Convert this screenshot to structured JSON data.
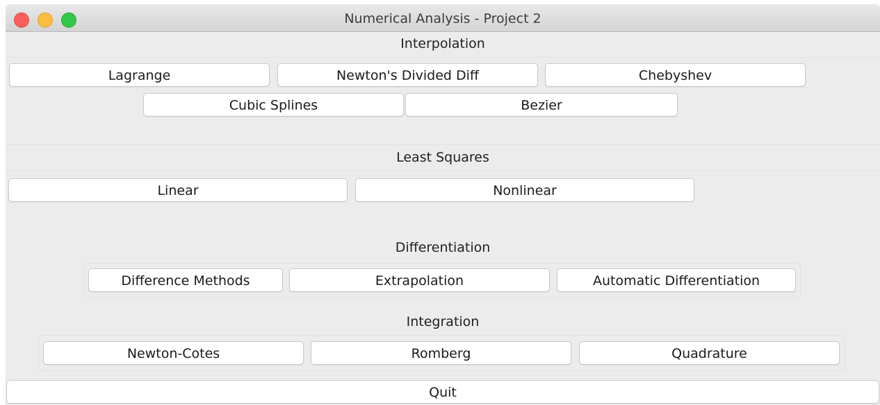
{
  "window": {
    "title": "Numerical Analysis - Project 2"
  },
  "sections": {
    "interpolation": {
      "label": "Interpolation",
      "buttons": {
        "lagrange": "Lagrange",
        "newton_divided_diff": "Newton's Divided Diff",
        "chebyshev": "Chebyshev",
        "cubic_splines": "Cubic Splines",
        "bezier": "Bezier"
      }
    },
    "least_squares": {
      "label": "Least Squares",
      "buttons": {
        "linear": "Linear",
        "nonlinear": "Nonlinear"
      }
    },
    "differentiation": {
      "label": "Differentiation",
      "buttons": {
        "difference_methods": "Difference Methods",
        "extrapolation": "Extrapolation",
        "automatic_differentiation": "Automatic Differentiation"
      }
    },
    "integration": {
      "label": "Integration",
      "buttons": {
        "newton_cotes": "Newton-Cotes",
        "romberg": "Romberg",
        "quadrature": "Quadrature"
      }
    }
  },
  "footer": {
    "quit": "Quit"
  },
  "colors": {
    "close": "#fc605c",
    "minimize": "#fdbc40",
    "maximize": "#34c84a",
    "background": "#ececec"
  }
}
